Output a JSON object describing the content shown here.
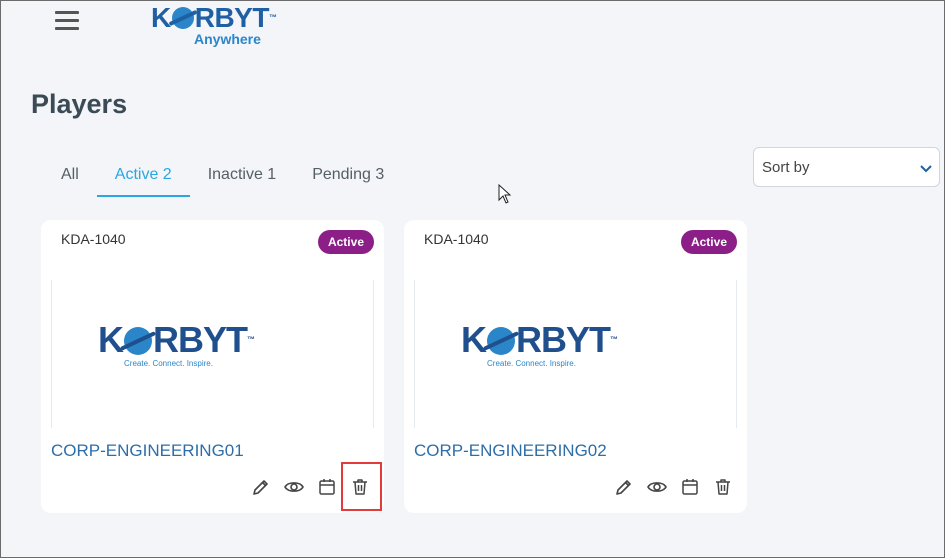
{
  "header": {
    "brand_wordmark_pre": "K",
    "brand_wordmark_post": "RBYT",
    "brand_tm": "™",
    "brand_sub": "Anywhere"
  },
  "page": {
    "title": "Players"
  },
  "tabs": [
    {
      "label": "All"
    },
    {
      "label": "Active 2"
    },
    {
      "label": "Inactive 1"
    },
    {
      "label": "Pending 3"
    }
  ],
  "sort": {
    "label": "Sort by"
  },
  "players": [
    {
      "id": "KDA-1040",
      "status": "Active",
      "name": "CORP-ENGINEERING01",
      "logo_pre": "K",
      "logo_post": "RBYT",
      "logo_tm": "™",
      "logo_tagline": "Create. Connect. Inspire."
    },
    {
      "id": "KDA-1040",
      "status": "Active",
      "name": "CORP-ENGINEERING02",
      "logo_pre": "K",
      "logo_post": "RBYT",
      "logo_tm": "™",
      "logo_tagline": "Create. Connect. Inspire."
    }
  ],
  "colors": {
    "accent": "#2aa7e0",
    "badge": "#8b1f87",
    "link": "#2e6ea8",
    "highlight": "#e23b3b"
  },
  "icons": {
    "menu": "hamburger-icon",
    "sort": "chevron-down-icon",
    "edit": "pencil-icon",
    "view": "eye-icon",
    "schedule": "calendar-icon",
    "delete": "trash-icon"
  }
}
